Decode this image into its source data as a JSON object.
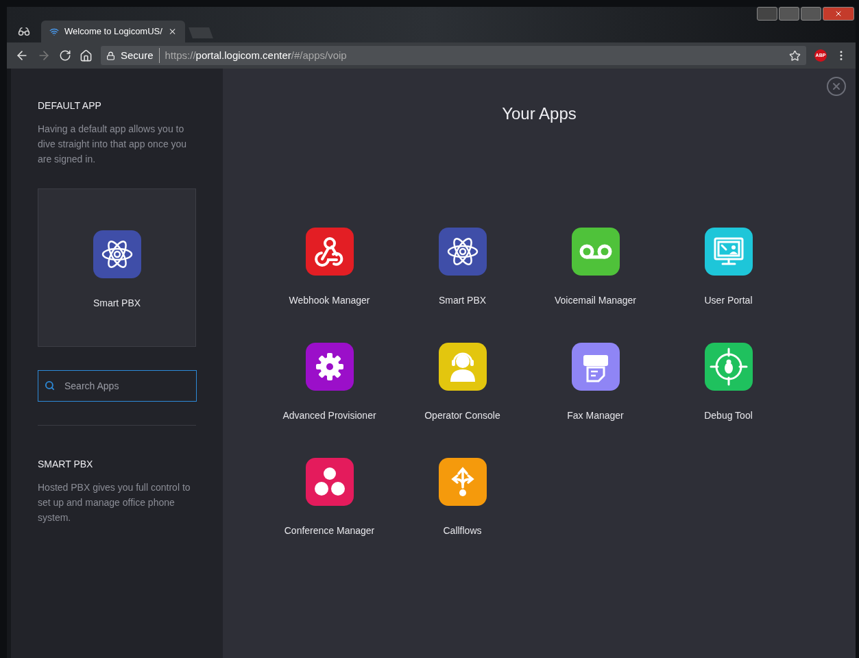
{
  "browser": {
    "tab": {
      "title": "Welcome to LogicomUS/",
      "selected": true
    },
    "security": "Secure",
    "url_scheme": "https://",
    "url_host": "portal.logicom.center",
    "url_path": "/#/apps/voip",
    "extension": "ABP"
  },
  "sidebar": {
    "default_app": {
      "heading": "DEFAULT APP",
      "description": "Having a default app allows you to dive straight into that app once you are signed in.",
      "app": {
        "name": "Smart PBX",
        "kind": "atom",
        "color": "#3f4ea8"
      }
    },
    "search": {
      "placeholder": "Search Apps"
    },
    "info": {
      "heading": "SMART PBX",
      "description": "Hosted PBX gives you full control to set up and manage office phone system."
    }
  },
  "main": {
    "title": "Your Apps",
    "apps": [
      {
        "name": "Webhook Manager",
        "kind": "webhook",
        "color": "#e31e24"
      },
      {
        "name": "Smart PBX",
        "kind": "atom",
        "color": "#3f4ea8"
      },
      {
        "name": "Voicemail Manager",
        "kind": "voicemail",
        "color": "#4fc23a"
      },
      {
        "name": "User Portal",
        "kind": "portal",
        "color": "#1ec6d9"
      },
      {
        "name": "Advanced Provisioner",
        "kind": "gear",
        "color": "#9b0fc9"
      },
      {
        "name": "Operator Console",
        "kind": "operator",
        "color": "#e3c60e"
      },
      {
        "name": "Fax Manager",
        "kind": "fax",
        "color": "#8f85f5"
      },
      {
        "name": "Debug Tool",
        "kind": "debug",
        "color": "#1fc15e"
      },
      {
        "name": "Conference Manager",
        "kind": "conference",
        "color": "#e41b5c"
      },
      {
        "name": "Callflows",
        "kind": "callflows",
        "color": "#f59a0c"
      }
    ]
  }
}
